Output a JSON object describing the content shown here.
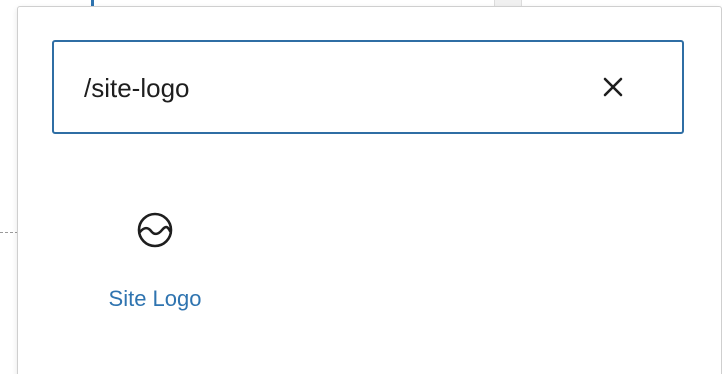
{
  "search": {
    "value": "/site-logo",
    "clear_icon": "close-icon"
  },
  "results": [
    {
      "label": "Site Logo",
      "icon": "site-logo-icon"
    }
  ],
  "colors": {
    "accent": "#2f6ea4",
    "link": "#2f74b0",
    "text": "#1e1e1e"
  }
}
